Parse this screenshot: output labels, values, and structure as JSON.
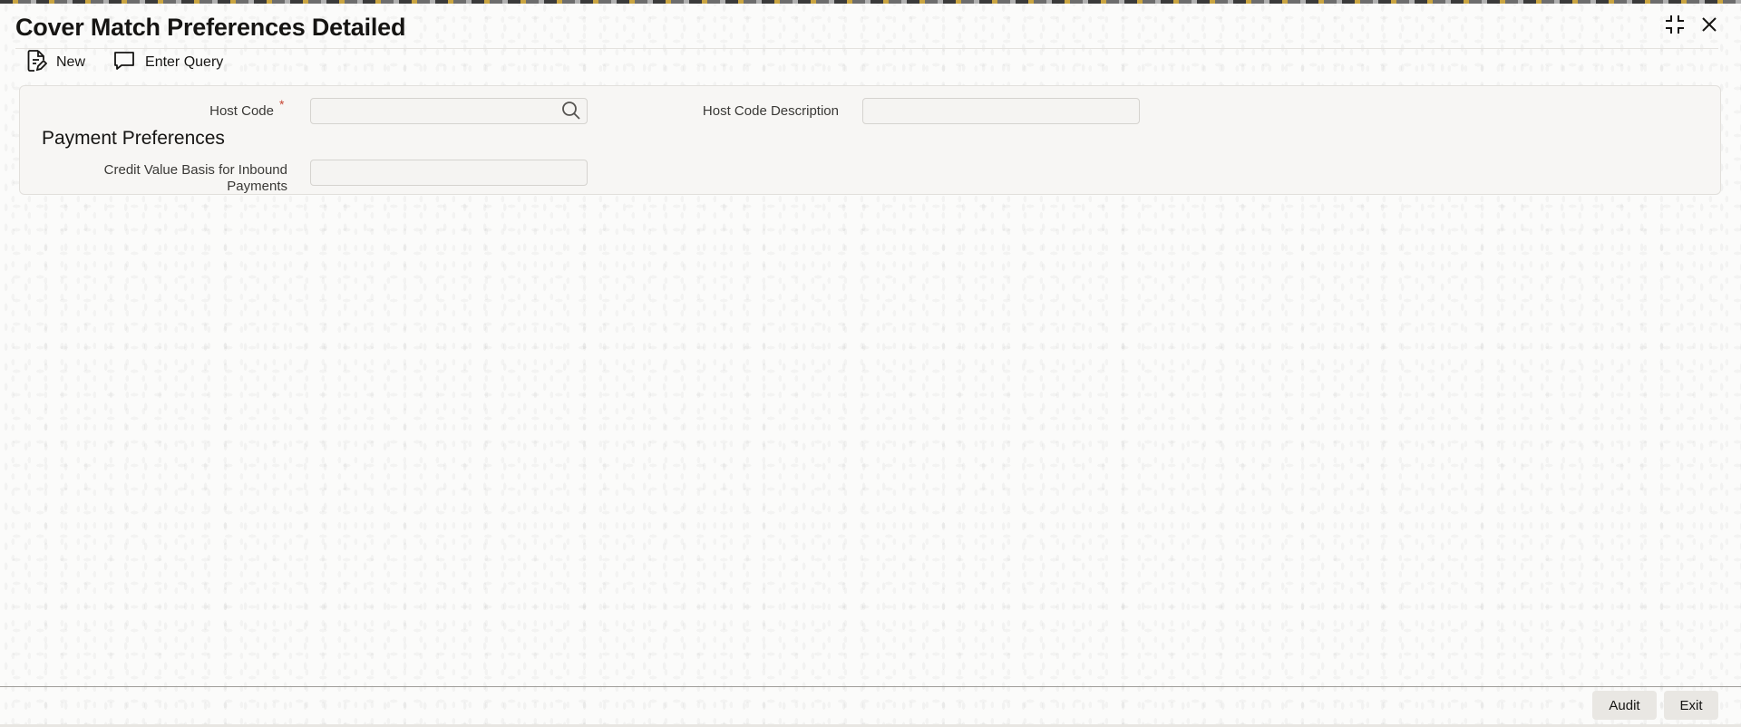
{
  "window": {
    "title": "Cover Match Preferences Detailed",
    "controls": [
      {
        "icon": "collapse-icon"
      },
      {
        "icon": "close-icon"
      }
    ]
  },
  "toolbar": {
    "new_label": "New",
    "new_icon": "new-document-icon",
    "enter_query_label": "Enter Query",
    "enter_query_icon": "chat-bubble-icon"
  },
  "form": {
    "host_code": {
      "label": "Host Code",
      "required_mark": "*",
      "value": "",
      "search_icon": "search-icon"
    },
    "host_code_description": {
      "label": "Host Code Description",
      "value": ""
    },
    "payment_preferences": {
      "section_title": "Payment Preferences",
      "credit_value_basis": {
        "label_line1": "Credit Value Basis for Inbound",
        "label_line2": "Payments",
        "value": ""
      }
    }
  },
  "footer": {
    "audit_label": "Audit",
    "exit_label": "Exit"
  },
  "colors": {
    "required": "#c74634",
    "text": "#161513",
    "panel_bg": "#f7f6f4",
    "button_bg": "#e9e7e3"
  }
}
